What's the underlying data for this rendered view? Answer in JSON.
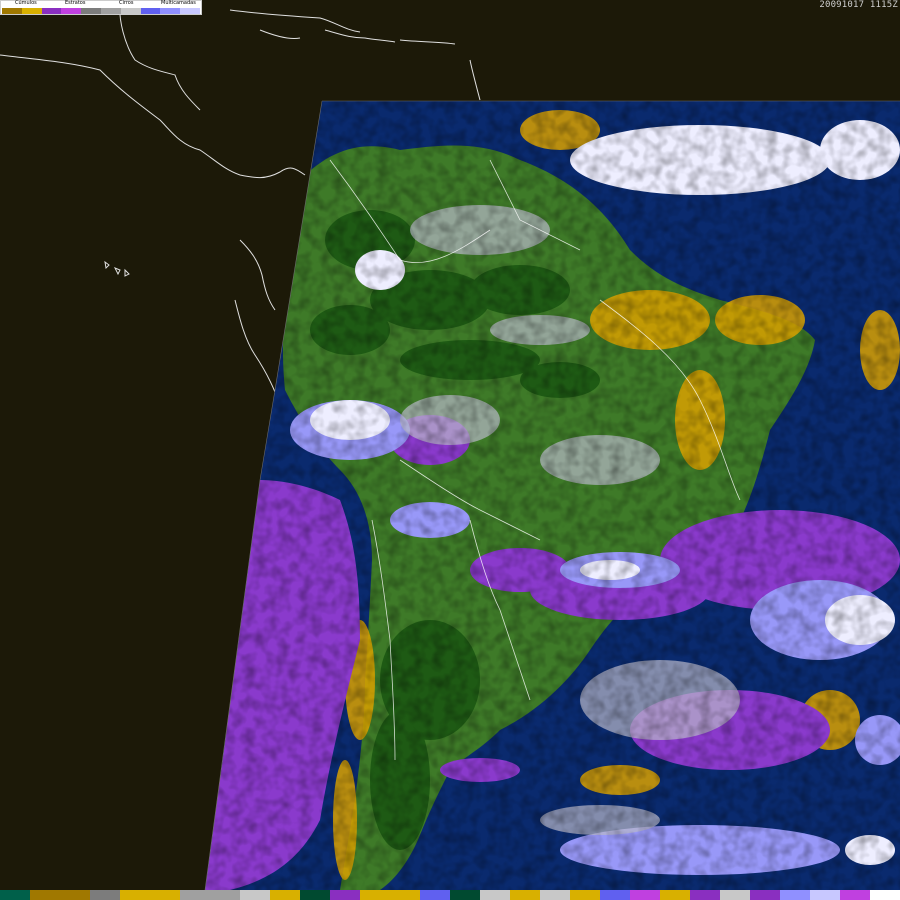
{
  "legend": {
    "categories": [
      {
        "label": "Cúmulos",
        "colors": [
          "#a07800",
          "#d8b000"
        ]
      },
      {
        "label": "Estratos",
        "colors": [
          "#8a2fc0",
          "#c040e0"
        ]
      },
      {
        "label": "Cirros",
        "colors": [
          "#7c7c7c",
          "#a0a0a0",
          "#c8c8c8"
        ]
      },
      {
        "label": "Multicamadas",
        "colors": [
          "#6060f0",
          "#9090ff",
          "#c8c8ff"
        ]
      }
    ]
  },
  "timestamp": "20091017 1115Z",
  "colorbar": [
    "#00604a",
    "#a07800",
    "#a07800",
    "#7c7c7c",
    "#d8b000",
    "#d8b000",
    "#a0a0a0",
    "#a0a0a0",
    "#c8c8c8",
    "#d8b000",
    "#004a30",
    "#8a2fc0",
    "#d8b000",
    "#d8b000",
    "#6060f0",
    "#004a30",
    "#c8c8c8",
    "#d8b000",
    "#c8c8c8",
    "#d8b000",
    "#6060f0",
    "#c040e0",
    "#d8b000",
    "#8a2fc0",
    "#c8c8c8",
    "#8a2fc0",
    "#9090ff",
    "#c8c8ff",
    "#c040e0",
    "#ffffff"
  ],
  "map": {
    "background": "#1c1908",
    "ocean": "#0a2a6e",
    "land": "#3e7a28",
    "land_dark": "#1e5a14",
    "cumulus": "#d8a000",
    "stratus": "#8a3acc",
    "cirrus": "#b8b8c8",
    "multilayer": "#9898f8",
    "cloud_white": "#eeeeff",
    "borders": "#ffffff"
  }
}
